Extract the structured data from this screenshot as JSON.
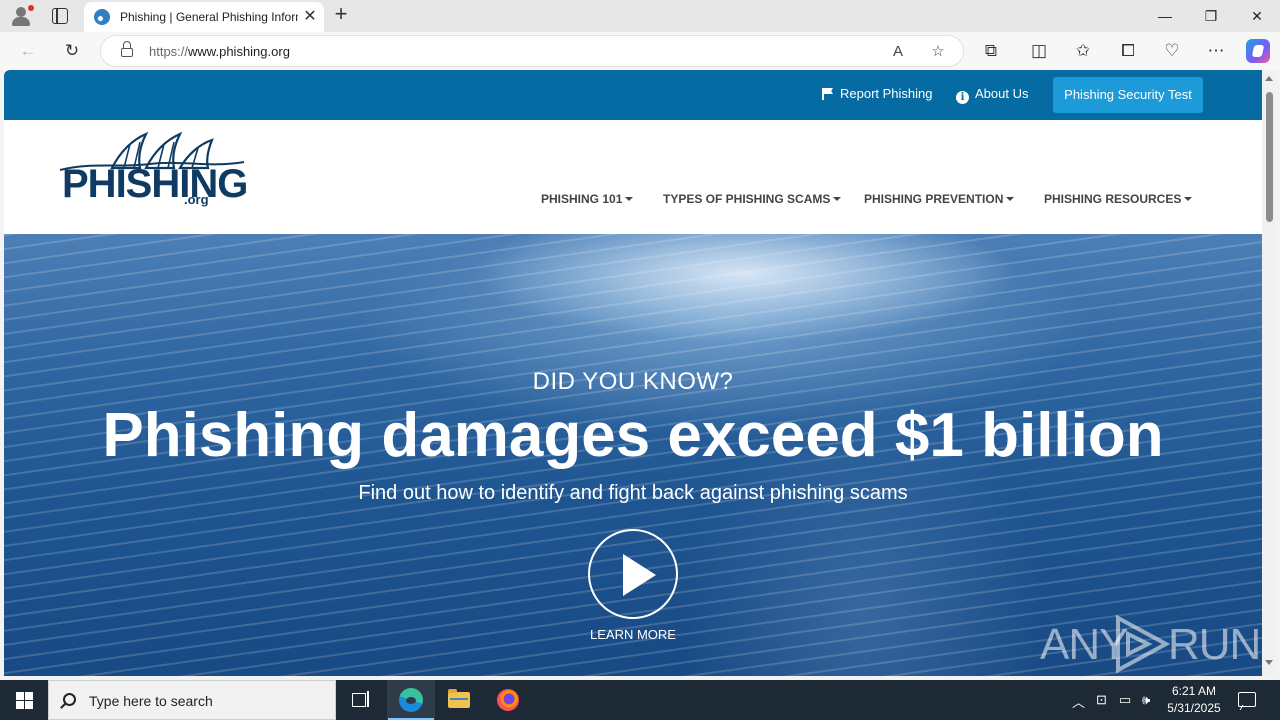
{
  "browser": {
    "tab_title": "Phishing | General Phishing Information",
    "tab_close": "✕",
    "new_tab": "+",
    "url_protocol": "https://",
    "url_host": "www.phishing.org",
    "window_controls": {
      "minimize": "—",
      "restore": "❐",
      "close": "✕"
    },
    "toolbar_icons": [
      "back-icon",
      "refresh-icon",
      "read-aloud-icon",
      "favorite-star-icon",
      "extensions-icon",
      "split-screen-icon",
      "favorites-icon",
      "collections-icon",
      "browser-essentials-icon",
      "more-icon",
      "copilot-icon"
    ]
  },
  "site": {
    "top_links": {
      "report": "Report Phishing",
      "about": "About Us",
      "test_button": "Phishing Security Test"
    },
    "logo": {
      "word": "PHISHING",
      "suffix": ".org"
    },
    "nav": [
      {
        "label": "PHISHING 101"
      },
      {
        "label": "TYPES OF PHISHING SCAMS"
      },
      {
        "label": "PHISHING PREVENTION"
      },
      {
        "label": "PHISHING RESOURCES"
      }
    ],
    "hero": {
      "kicker": "DID YOU KNOW?",
      "title": "Phishing damages exceed $1 billion",
      "subtitle": "Find out how to identify and fight back against phishing scams",
      "cta": "LEARN MORE"
    },
    "watermark": {
      "left": "ANY",
      "right": "RUN"
    }
  },
  "taskbar": {
    "search_placeholder": "Type here to search",
    "time": "6:21 AM",
    "date": "5/31/2025"
  },
  "colors": {
    "topbar": "#066aa3",
    "test_button": "#1c9bd8",
    "logo": "#0f3b63",
    "taskbar": "#1d2a36"
  }
}
